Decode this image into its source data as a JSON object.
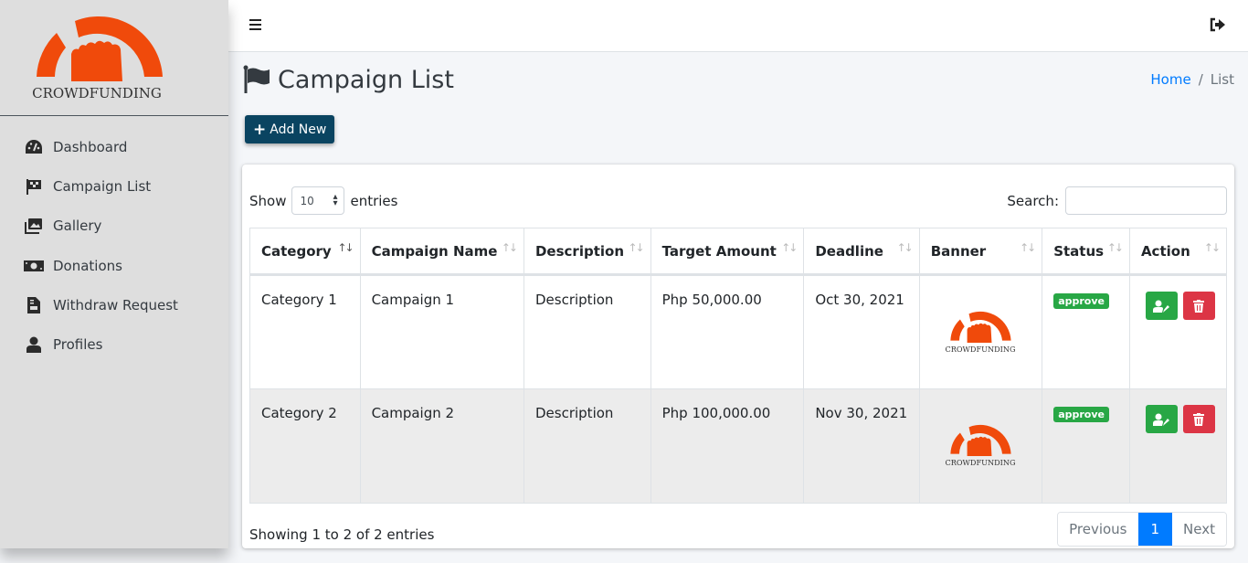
{
  "brand": {
    "name": "CROWDFUNDING",
    "color": "#f04a0b"
  },
  "sidebar": {
    "items": [
      {
        "label": "Dashboard",
        "icon": "tachometer-icon"
      },
      {
        "label": "Campaign List",
        "icon": "checkered-flag-icon"
      },
      {
        "label": "Gallery",
        "icon": "images-icon"
      },
      {
        "label": "Donations",
        "icon": "money-bill-icon"
      },
      {
        "label": "Withdraw Request",
        "icon": "file-invoice-icon"
      },
      {
        "label": "Profiles",
        "icon": "user-icon"
      }
    ]
  },
  "topbar": {
    "menu_icon": "bars-icon",
    "logout_icon": "sign-out-icon"
  },
  "page": {
    "title": "Campaign List",
    "title_icon": "flag-icon",
    "breadcrumb": {
      "home": "Home",
      "separator": "/",
      "current": "List"
    },
    "add_button": "Add New",
    "add_icon": "+"
  },
  "table_controls": {
    "show_label": "Show",
    "entries_label": "entries",
    "page_length": "10",
    "search_label": "Search:",
    "search_value": ""
  },
  "table": {
    "columns": [
      "Category",
      "Campaign Name",
      "Description",
      "Target Amount",
      "Deadline",
      "Banner",
      "Status",
      "Action"
    ],
    "rows": [
      {
        "category": "Category 1",
        "name": "Campaign 1",
        "description": "Description",
        "target": "Php 50,000.00",
        "deadline": "Oct 30, 2021",
        "banner": "CROWDFUNDING",
        "status": "approve"
      },
      {
        "category": "Category 2",
        "name": "Campaign 2",
        "description": "Description",
        "target": "Php 100,000.00",
        "deadline": "Nov 30, 2021",
        "banner": "CROWDFUNDING",
        "status": "approve"
      }
    ]
  },
  "footer": {
    "info": "Showing 1 to 2 of 2 entries",
    "pagination": {
      "previous": "Previous",
      "current": "1",
      "next": "Next"
    }
  },
  "colors": {
    "primary": "#007bff",
    "success": "#28a745",
    "danger": "#dc3545",
    "add_button": "#0a4461"
  }
}
